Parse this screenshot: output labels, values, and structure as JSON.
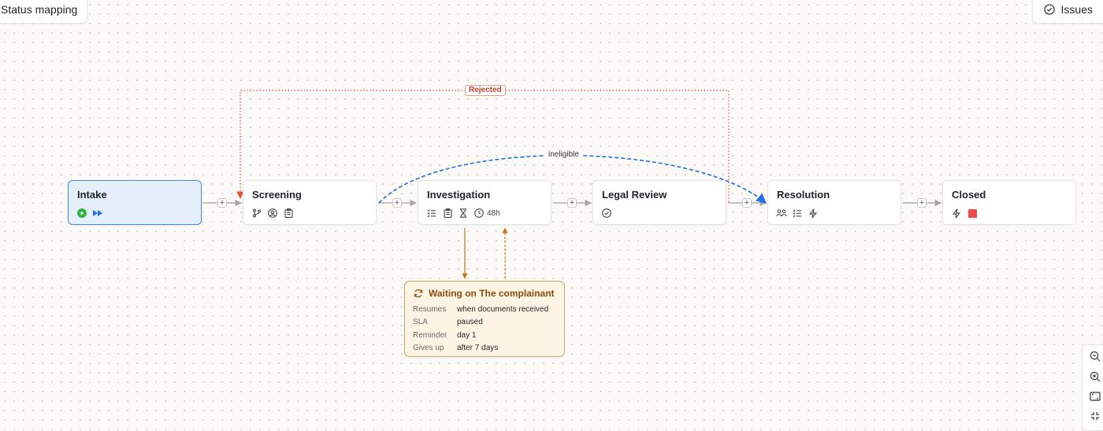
{
  "toolbar": {
    "status_mapping_label": "Status mapping",
    "issues_label": "Issues"
  },
  "nodes": [
    {
      "title": "Intake",
      "icons": [
        "play-icon",
        "fast-forward-icon"
      ],
      "state": "start"
    },
    {
      "title": "Screening",
      "icons": [
        "branch-icon",
        "user-circle-icon",
        "clipboard-icon"
      ]
    },
    {
      "title": "Investigation",
      "icons": [
        "checklist-icon",
        "clipboard-icon",
        "hourglass-icon",
        "clock-icon"
      ],
      "meta": "48h"
    },
    {
      "title": "Legal Review",
      "icons": [
        "check-circle-icon"
      ]
    },
    {
      "title": "Resolution",
      "icons": [
        "users-icon",
        "checklist-icon",
        "bolt-icon"
      ]
    },
    {
      "title": "Closed",
      "icons": [
        "bolt-icon",
        "stop-icon"
      ]
    }
  ],
  "edges": {
    "rejected_label": "Rejected",
    "ineligible_label": "ineligible",
    "add_label": "+"
  },
  "wait": {
    "title": "Waiting on The complainant",
    "rows": [
      {
        "key": "Resumes",
        "value": "when documents received"
      },
      {
        "key": "SLA",
        "value": "paused"
      },
      {
        "key": "Reminder",
        "value": "day 1"
      },
      {
        "key": "Gives up",
        "value": "after 7 days"
      }
    ]
  },
  "colors": {
    "start_fill": "#e6f0fc",
    "start_border": "#4a86d9",
    "rejected": "#e0533a",
    "ineligible": "#1f6fe5",
    "wait_fill": "#fdf4e4",
    "wait_line": "#c47a1a",
    "play": "#2fb344",
    "stop": "#f04a4a"
  },
  "zoom": {
    "icons": [
      "zoom-out-icon",
      "zoom-in-icon",
      "fit-view-icon",
      "collapse-icon"
    ]
  }
}
